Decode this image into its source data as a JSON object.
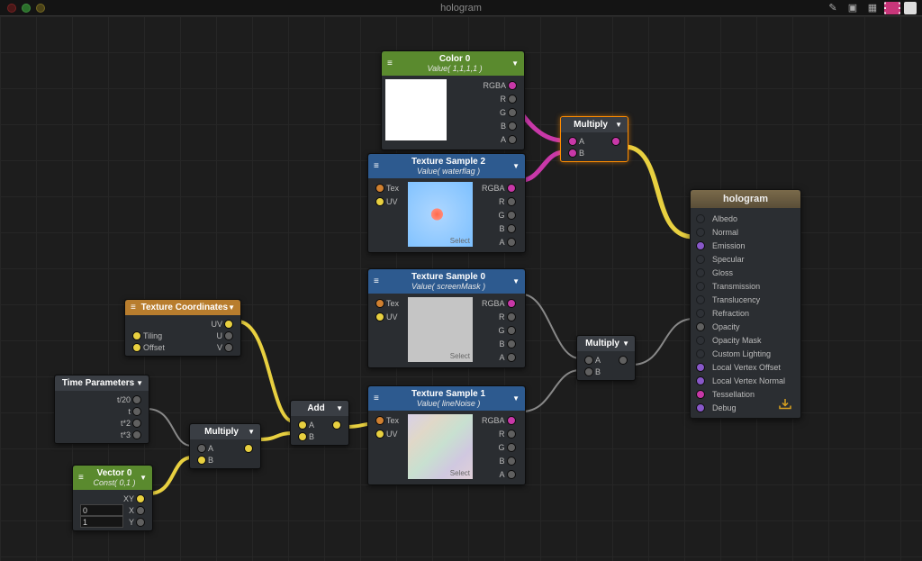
{
  "app": {
    "title": "hologram"
  },
  "toolbar": {
    "icons": [
      "wand-icon",
      "layout-icon",
      "add-icon",
      "grid-icon",
      "maximize-icon"
    ]
  },
  "nodes": {
    "color0": {
      "title": "Color 0",
      "subtitle": "Value( 1,1,1,1 )",
      "outputs": [
        "RGBA",
        "R",
        "G",
        "B",
        "A"
      ]
    },
    "tex2": {
      "title": "Texture Sample 2",
      "subtitle": "Value( waterflag )",
      "inputs": [
        "Tex",
        "UV"
      ],
      "outputs": [
        "RGBA",
        "R",
        "G",
        "B",
        "A"
      ],
      "select": "Select"
    },
    "tex0": {
      "title": "Texture Sample 0",
      "subtitle": "Value( screenMask )",
      "inputs": [
        "Tex",
        "UV"
      ],
      "outputs": [
        "RGBA",
        "R",
        "G",
        "B",
        "A"
      ],
      "select": "Select"
    },
    "tex1": {
      "title": "Texture Sample 1",
      "subtitle": "Value( lineNoise )",
      "inputs": [
        "Tex",
        "UV"
      ],
      "outputs": [
        "RGBA",
        "R",
        "G",
        "B",
        "A"
      ],
      "select": "Select"
    },
    "mult1": {
      "title": "Multiply",
      "inputs": [
        "A",
        "B"
      ]
    },
    "mult2": {
      "title": "Multiply",
      "inputs": [
        "A",
        "B"
      ]
    },
    "mult3": {
      "title": "Multiply",
      "inputs": [
        "A",
        "B"
      ]
    },
    "add": {
      "title": "Add",
      "inputs": [
        "A",
        "B"
      ]
    },
    "texcoord": {
      "title": "Texture Coordinates",
      "inputs": [
        "Tiling",
        "Offset"
      ],
      "outputs": [
        "UV",
        "U",
        "V"
      ]
    },
    "time": {
      "title": "Time Parameters",
      "outputs": [
        "t/20",
        "t",
        "t*2",
        "t*3"
      ]
    },
    "vec0": {
      "title": "Vector 0",
      "subtitle": "Const( 0,1 )",
      "outputs": [
        "XY",
        "X",
        "Y"
      ],
      "field_x": "0",
      "field_y": "1"
    },
    "out": {
      "title": "hologram",
      "rows": [
        {
          "label": "Albedo",
          "active": false
        },
        {
          "label": "Normal",
          "active": false
        },
        {
          "label": "Emission",
          "active": true,
          "color": "purple"
        },
        {
          "label": "Specular",
          "active": false
        },
        {
          "label": "Gloss",
          "active": false
        },
        {
          "label": "Transmission",
          "active": false
        },
        {
          "label": "Translucency",
          "active": false
        },
        {
          "label": "Refraction",
          "active": false
        },
        {
          "label": "Opacity",
          "active": true,
          "color": "grey"
        },
        {
          "label": "Opacity Mask",
          "active": false
        },
        {
          "label": "Custom Lighting",
          "active": false
        },
        {
          "label": "Local Vertex Offset",
          "active": true,
          "color": "purple"
        },
        {
          "label": "Local Vertex Normal",
          "active": true,
          "color": "purple"
        },
        {
          "label": "Tessellation",
          "active": true,
          "color": "magenta"
        },
        {
          "label": "Debug",
          "active": true,
          "color": "purple"
        }
      ]
    }
  }
}
